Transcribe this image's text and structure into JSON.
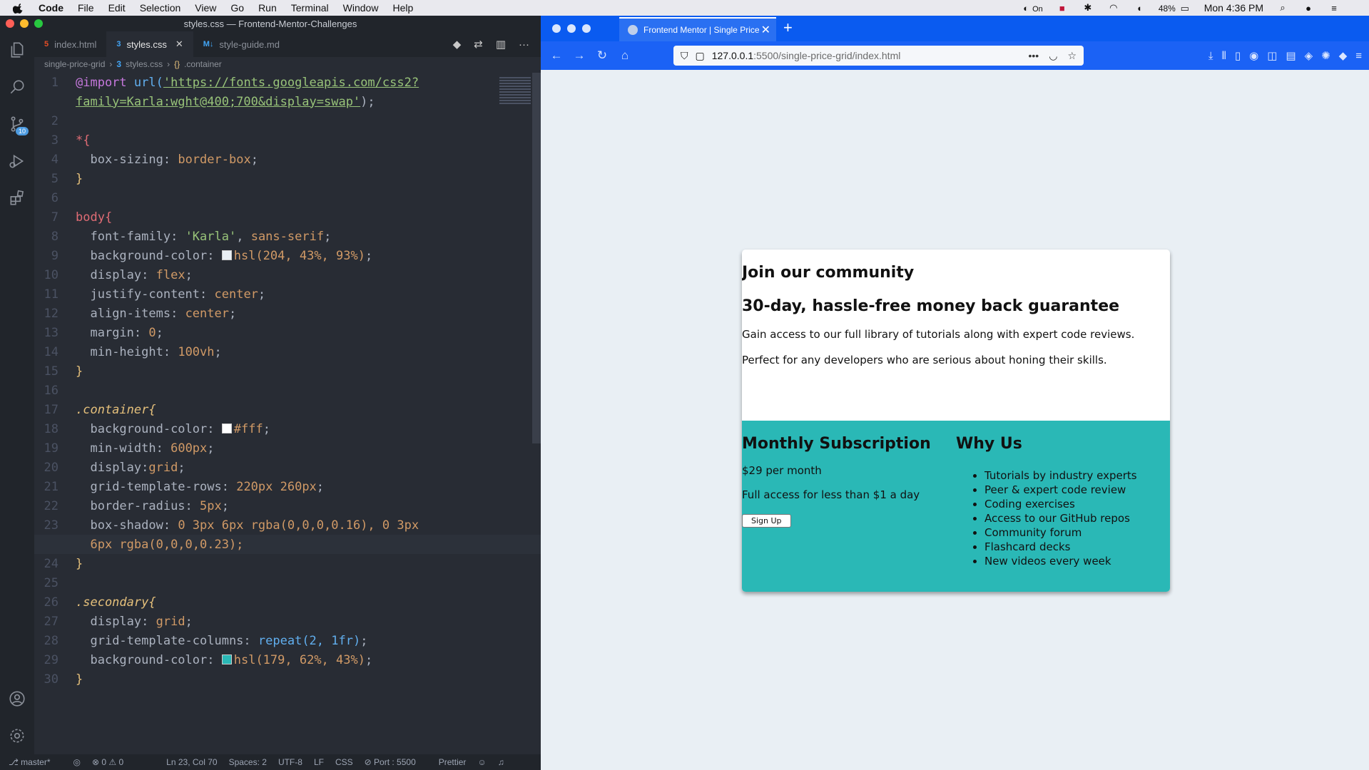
{
  "menubar": {
    "app": "Code",
    "items": [
      "File",
      "Edit",
      "Selection",
      "View",
      "Go",
      "Run",
      "Terminal",
      "Window",
      "Help"
    ],
    "status_on": "On",
    "battery": "48%",
    "clock": "Mon 4:36 PM"
  },
  "vscode": {
    "title": "styles.css — Frontend-Mentor-Challenges",
    "scm_badge": "10",
    "tabs": [
      {
        "label": "index.html",
        "icon": "html-icon"
      },
      {
        "label": "styles.css",
        "icon": "css-icon"
      },
      {
        "label": "style-guide.md",
        "icon": "markdown-icon"
      }
    ],
    "breadcrumb": [
      "single-price-grid",
      "styles.css",
      ".container"
    ],
    "lines": [
      "1",
      "2",
      "3",
      "4",
      "5",
      "6",
      "7",
      "8",
      "9",
      "10",
      "11",
      "12",
      "13",
      "14",
      "15",
      "16",
      "17",
      "18",
      "19",
      "20",
      "21",
      "22",
      "23",
      "",
      "24",
      "25",
      "26",
      "27",
      "28",
      "29",
      "30"
    ],
    "code": {
      "l1a": "@import",
      "l1b": "url(",
      "l1c": "'https://fonts.googleapis.com/css2?",
      "l1d": "family=Karla:wght@400;700&display=swap'",
      "l1e": ");",
      "l3": "*{",
      "l4p": "box-sizing",
      "l4v": "border-box",
      "l5": "}",
      "l7": "body{",
      "l8p": "font-family",
      "l8v1": "'Karla'",
      "l8v2": "sans-serif",
      "l9p": "background-color",
      "l9v": "hsl(204, 43%, 93%)",
      "l10p": "display",
      "l10v": "flex",
      "l11p": "justify-content",
      "l11v": "center",
      "l12p": "align-items",
      "l12v": "center",
      "l13p": "margin",
      "l13v": "0",
      "l14p": "min-height",
      "l14v": "100vh",
      "l15": "}",
      "l17": ".container{",
      "l18p": "background-color",
      "l18v": "#fff",
      "l19p": "min-width",
      "l19v": "600px",
      "l20p": "display",
      "l20v": "grid",
      "l21p": "grid-template-rows",
      "l21v": "220px 260px",
      "l22p": "border-radius",
      "l22v": "5px",
      "l23p": "box-shadow",
      "l23v": "0 3px 6px rgba(0,0,0,0.16), 0 3px",
      "l23w": "6px rgba(0,0,0,0.23);",
      "l24": "}",
      "l26": ".secondary{",
      "l27p": "display",
      "l27v": "grid",
      "l28p": "grid-template-columns",
      "l28v": "repeat(2, 1fr)",
      "l29p": "background-color",
      "l29v": "hsl(179, 62%, 43%)",
      "l30": "}"
    },
    "status": {
      "branch": "master*",
      "problems": "⊗ 0 ⚠ 0",
      "position": "Ln 23, Col 70",
      "spaces": "Spaces: 2",
      "encoding": "UTF-8",
      "eol": "LF",
      "language": "CSS",
      "port": "Port : 5500",
      "formatter": "Prettier"
    }
  },
  "browser": {
    "tab_title": "Frontend Mentor | Single Price",
    "url_host": "127.0.0.1",
    "url_path": ":5500/single-price-grid/index.html",
    "page": {
      "h1": "Join our community",
      "h2": "30-day, hassle-free money back guarantee",
      "p1": "Gain access to our full library of tutorials along with expert code reviews.",
      "p2": "Perfect for any developers who are serious about honing their skills.",
      "monthly_title": "Monthly Subscription",
      "price": "$29 per month",
      "access": "Full access for less than $1 a day",
      "signup": "Sign Up",
      "why_title": "Why Us",
      "why_items": [
        "Tutorials by industry experts",
        "Peer & expert code review",
        "Coding exercises",
        "Access to our GitHub repos",
        "Community forum",
        "Flashcard decks",
        "New videos every week"
      ]
    }
  },
  "colors": {
    "card_teal": "#2ab8b6",
    "page_bg": "#e9eff4",
    "browser_accent": "#1b62f5"
  }
}
